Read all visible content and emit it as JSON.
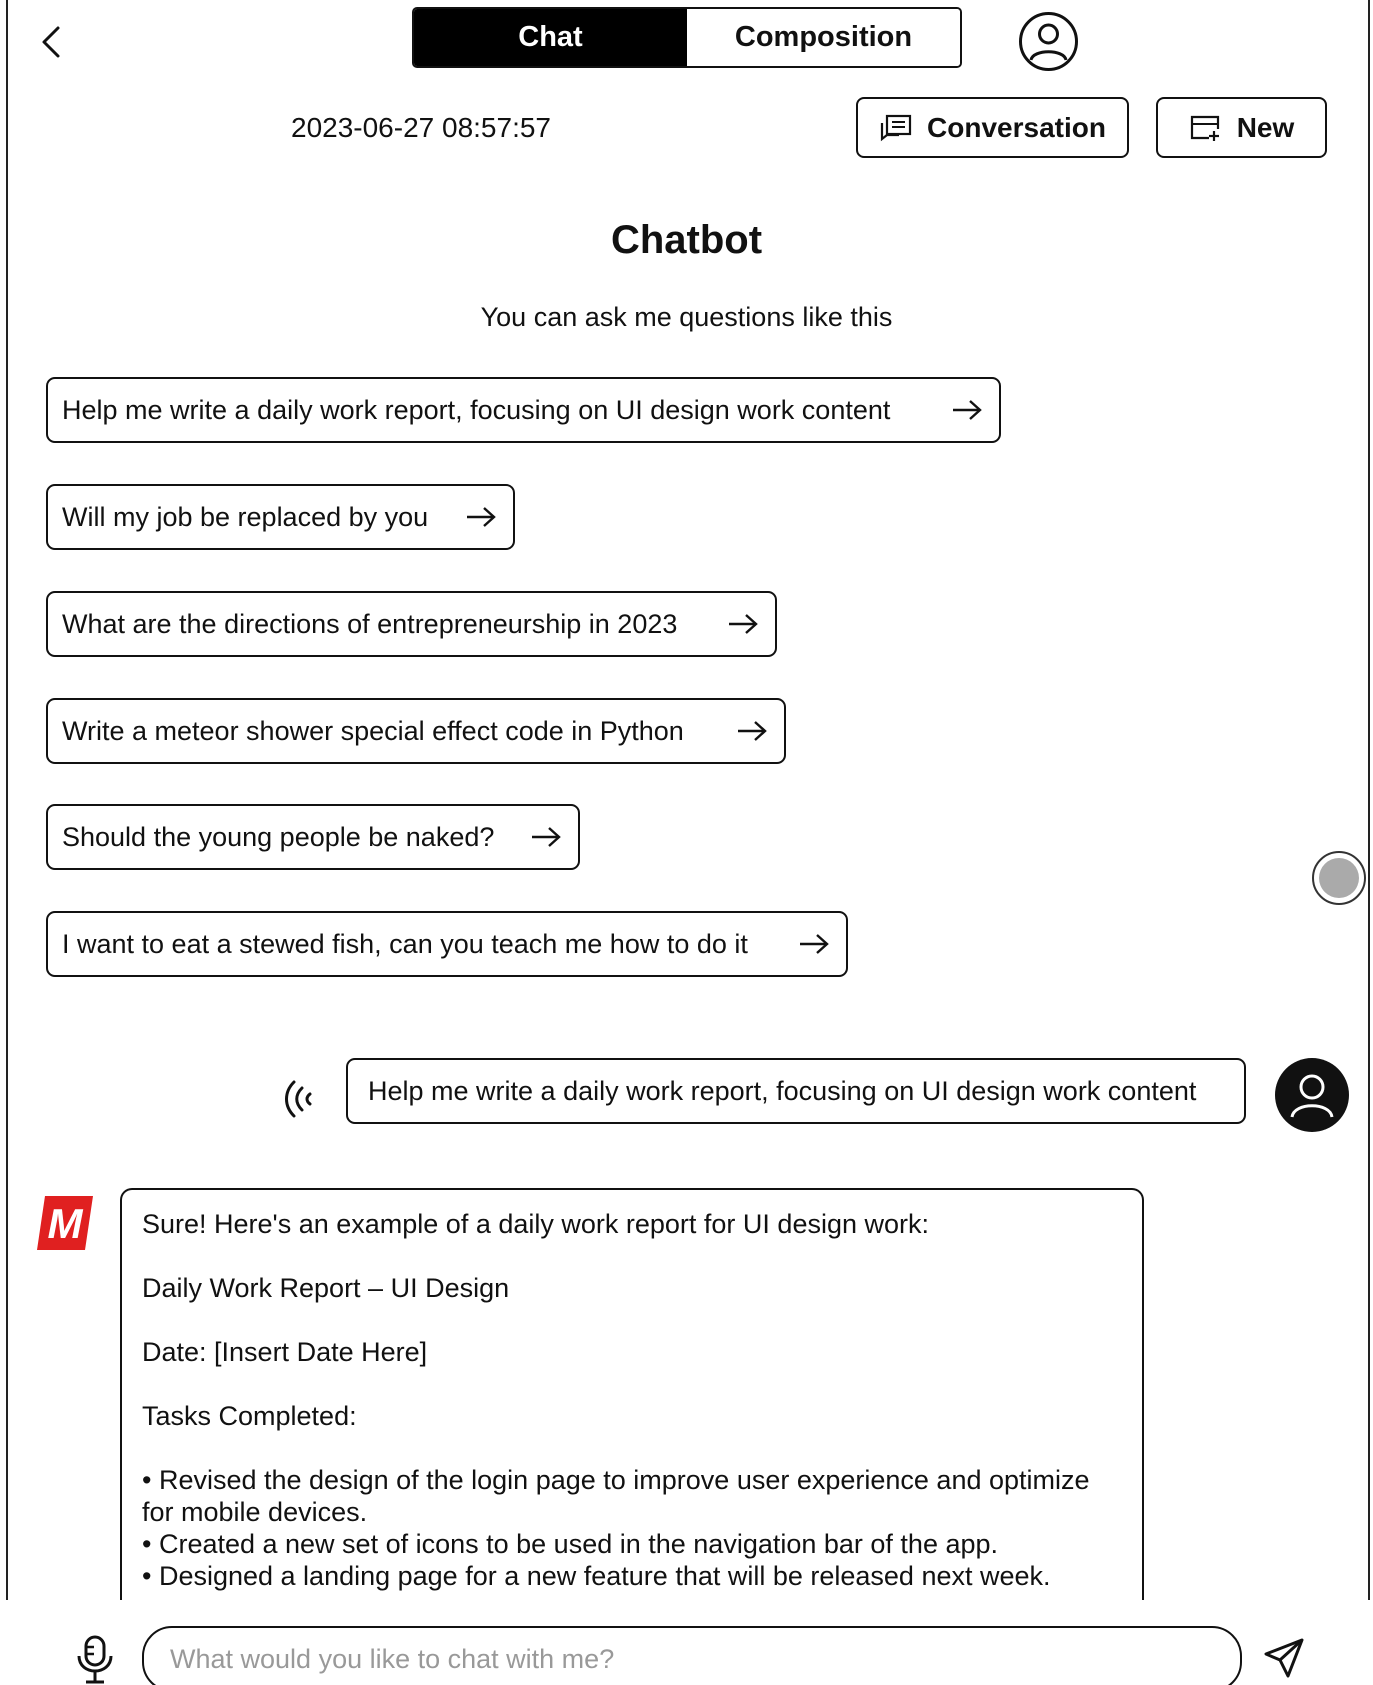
{
  "header": {
    "tabs": [
      {
        "label": "Chat",
        "active": true
      },
      {
        "label": "Composition",
        "active": false
      }
    ],
    "timestamp": "2023-06-27 08:57:57",
    "conversation_label": "Conversation",
    "new_label": "New"
  },
  "intro": {
    "title": "Chatbot",
    "subtitle": "You can ask me questions like this"
  },
  "suggestions": [
    "Help me write a daily work report, focusing on UI design work content",
    "Will my job be replaced by you",
    "What are the directions of entrepreneurship in 2023",
    "Write a meteor shower special effect code in Python",
    "Should the young people be naked?",
    "I want to eat a stewed fish, can you teach me how to do it"
  ],
  "messages": {
    "user": "Help me write a daily work report, focusing on UI design work content",
    "bot_logo_text": "M",
    "bot": {
      "intro": "Sure! Here's an example of a daily work report for UI design work:",
      "heading": "Daily Work Report – UI Design",
      "date": "Date: [Insert Date Here]",
      "tasks_heading": "Tasks Completed:",
      "tasks": [
        "• Revised the design of the login page to improve user experience and optimize for mobile devices.",
        "• Created a new set of icons to be used in the navigation bar of the app.",
        "• Designed a landing page for a new feature that will be released next week."
      ]
    }
  },
  "composer": {
    "placeholder": "What would you like to chat with me?"
  },
  "colors": {
    "accent": "#000000",
    "brand_logo": "#e02020",
    "scroll_handle": "#aaaaaa"
  }
}
